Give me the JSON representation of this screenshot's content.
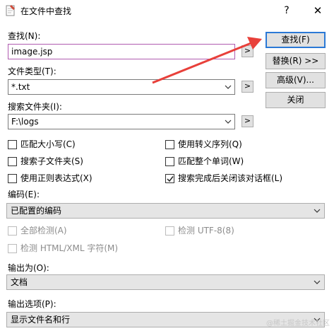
{
  "window": {
    "title": "在文件中查找",
    "help_glyph": "?",
    "close_glyph": "✕"
  },
  "find": {
    "label": "查找(N):",
    "value": "image.jsp"
  },
  "file_type": {
    "label": "文件类型(T):",
    "value": "*.txt"
  },
  "folder": {
    "label": "搜索文件夹(I):",
    "value": "F:\\logs"
  },
  "arrow_glyph": ">",
  "buttons": {
    "find": "查找(F)",
    "replace": "替换(R) >>",
    "advanced": "高级(V)...",
    "close": "关闭"
  },
  "options": [
    {
      "label": "匹配大小写(C)",
      "checked": false,
      "disabled": false
    },
    {
      "label": "使用转义序列(Q)",
      "checked": false,
      "disabled": false
    },
    {
      "label": "搜索子文件夹(S)",
      "checked": false,
      "disabled": false
    },
    {
      "label": "匹配整个单词(W)",
      "checked": false,
      "disabled": false
    },
    {
      "label": "使用正则表达式(X)",
      "checked": false,
      "disabled": false
    },
    {
      "label": "搜索完成后关闭该对话框(L)",
      "checked": true,
      "disabled": false
    }
  ],
  "encoding": {
    "label": "编码(E):",
    "value": "已配置的编码",
    "sub_options": [
      {
        "label": "全部检测(A)",
        "checked": false,
        "disabled": true
      },
      {
        "label": "检测 UTF-8(8)",
        "checked": false,
        "disabled": true
      },
      {
        "label": "检测 HTML/XML 字符(M)",
        "checked": false,
        "disabled": true
      }
    ]
  },
  "output_to": {
    "label": "输出为(O):",
    "value": "文档"
  },
  "output_options": {
    "label": "输出选项(P):",
    "value": "显示文件名和行"
  },
  "watermark": "@稀土掘金技术社区",
  "colors": {
    "annotation_arrow": "#e8403a",
    "default_button_border": "#2b79d6",
    "focus_border": "#b05bb0"
  }
}
